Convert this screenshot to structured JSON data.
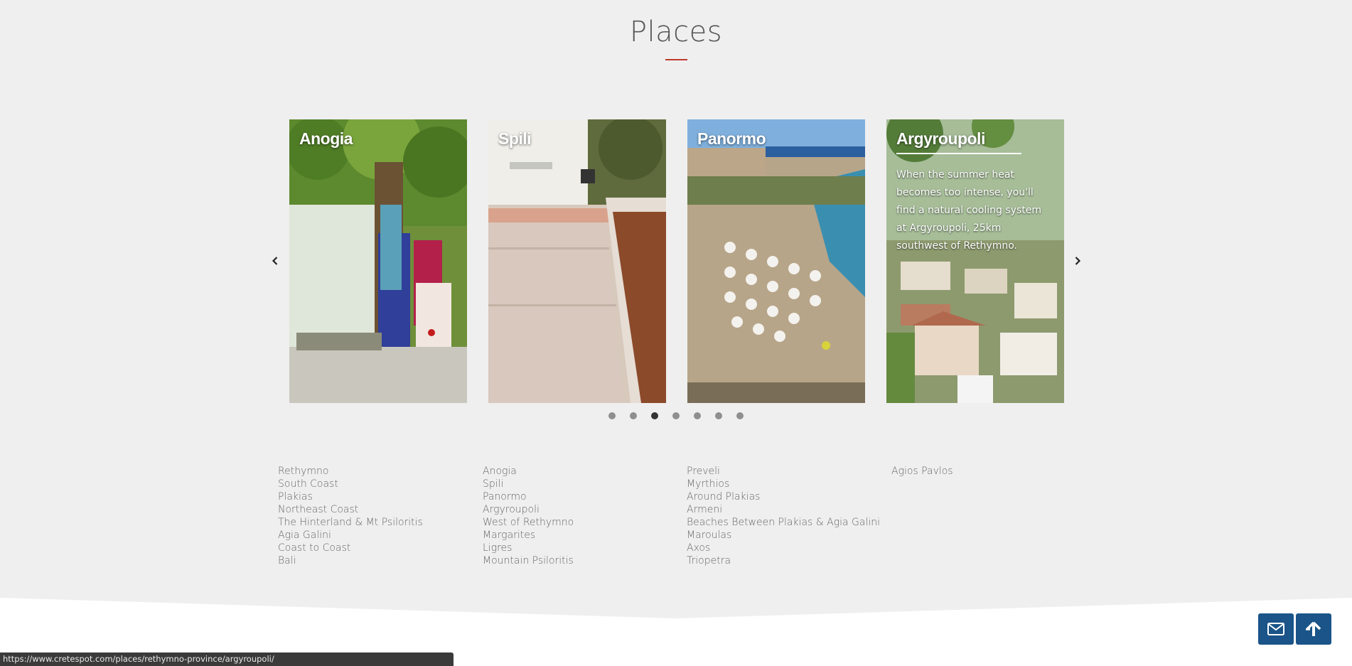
{
  "section": {
    "title": "Places"
  },
  "carousel": {
    "cards": [
      {
        "title": "Anogia",
        "description": ""
      },
      {
        "title": "Spili",
        "description": ""
      },
      {
        "title": "Panormo",
        "description": ""
      },
      {
        "title": "Argyroupoli",
        "description": "When the summer heat becomes too intense, you'll find a natural cooling system at Argyroupoli, 25km southwest of Rethymno."
      }
    ],
    "dots_count": 7,
    "active_dot": 3,
    "prev_icon": "chevron-left-icon",
    "next_icon": "chevron-right-icon"
  },
  "links": {
    "col1": [
      "Rethymno",
      "South Coast",
      "Plakias",
      "Northeast Coast",
      "The Hinterland & Mt Psiloritis",
      "Agia Galini",
      "Coast to Coast",
      "Bali"
    ],
    "col2": [
      "Anogia",
      "Spili",
      "Panormo",
      "Argyroupoli",
      "West of Rethymno",
      "Margarites",
      "Ligres",
      "Mountain Psiloritis"
    ],
    "col3": [
      "Preveli",
      "Myrthios",
      "Around Plakias",
      "Armeni",
      "Beaches Between Plakias & Agia Galini",
      "Maroulas",
      "Axos",
      "Triopetra"
    ],
    "col4": [
      "Agios Pavlos"
    ]
  },
  "buttons": {
    "mail_icon": "envelope-icon",
    "top_icon": "arrow-up-icon"
  },
  "status_bar": {
    "url": "https://www.cretespot.com/places/rethymno-province/argyroupoli/"
  },
  "colors": {
    "accent": "#c0392b",
    "button": "#1a5488",
    "background": "#efefef"
  }
}
